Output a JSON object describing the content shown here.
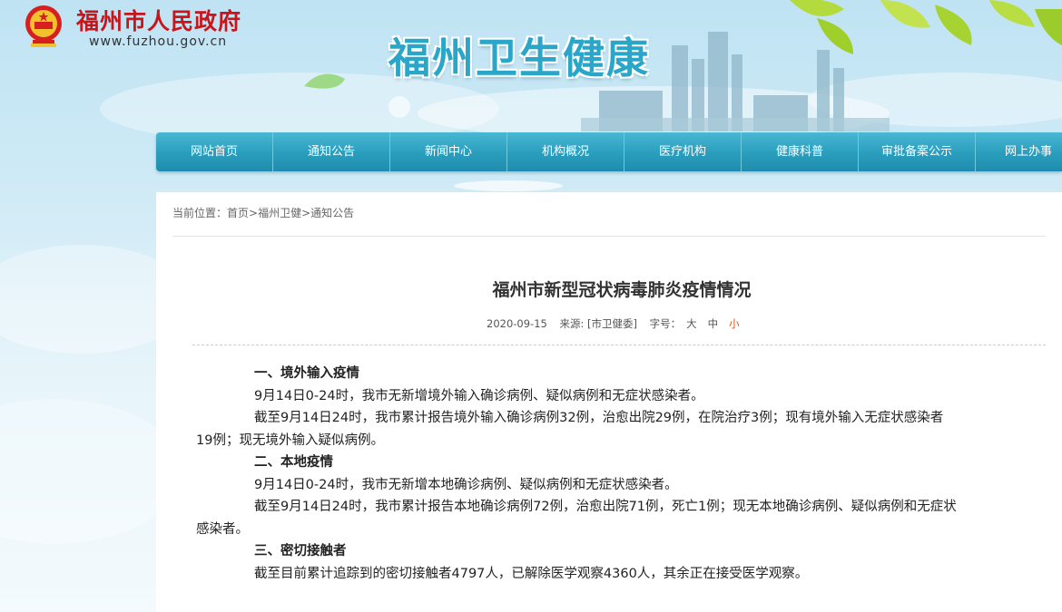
{
  "header": {
    "gov_title": "福州市人民政府",
    "gov_url": "www.fuzhou.gov.cn",
    "site_title": "福州卫生健康"
  },
  "nav": {
    "items": [
      "网站首页",
      "通知公告",
      "新闻中心",
      "机构概况",
      "医疗机构",
      "健康科普",
      "审批备案公示",
      "网上办事"
    ]
  },
  "breadcrumb": {
    "prefix": "当前位置：",
    "home": "首页",
    "sep1": ">",
    "section": "福州卫健",
    "sep2": ">",
    "current": "通知公告"
  },
  "article": {
    "title": "福州市新型冠状病毒肺炎疫情情况",
    "date": "2020-09-15",
    "source": "来源: [市卫健委]",
    "font_size_label": "字号：",
    "font_large": "大",
    "font_medium": "中",
    "font_small": "小",
    "paragraphs": [
      "一、境外输入疫情",
      "9月14日0-24时，我市无新增境外输入确诊病例、疑似病例和无症状感染者。",
      "截至9月14日24时，我市累计报告境外输入确诊病例32例，治愈出院29例，在院治疗3例；现有境外输入无症状感染者",
      "19例；现无境外输入疑似病例。",
      "二、本地疫情",
      "9月14日0-24时，我市无新增本地确诊病例、疑似病例和无症状感染者。",
      "截至9月14日24时，我市累计报告本地确诊病例72例，治愈出院71例，死亡1例；现无本地确诊病例、疑似病例和无症状",
      "感染者。",
      "三、密切接触者",
      "截至目前累计追踪到的密切接触者4797人，已解除医学观察4360人，其余正在接受医学观察。"
    ]
  },
  "colors": {
    "gov_red": "#c8141b",
    "nav_blue": "#2a9dbd",
    "site_title_blue": "#2aa6c9",
    "font_small_active": "#e3530f"
  }
}
